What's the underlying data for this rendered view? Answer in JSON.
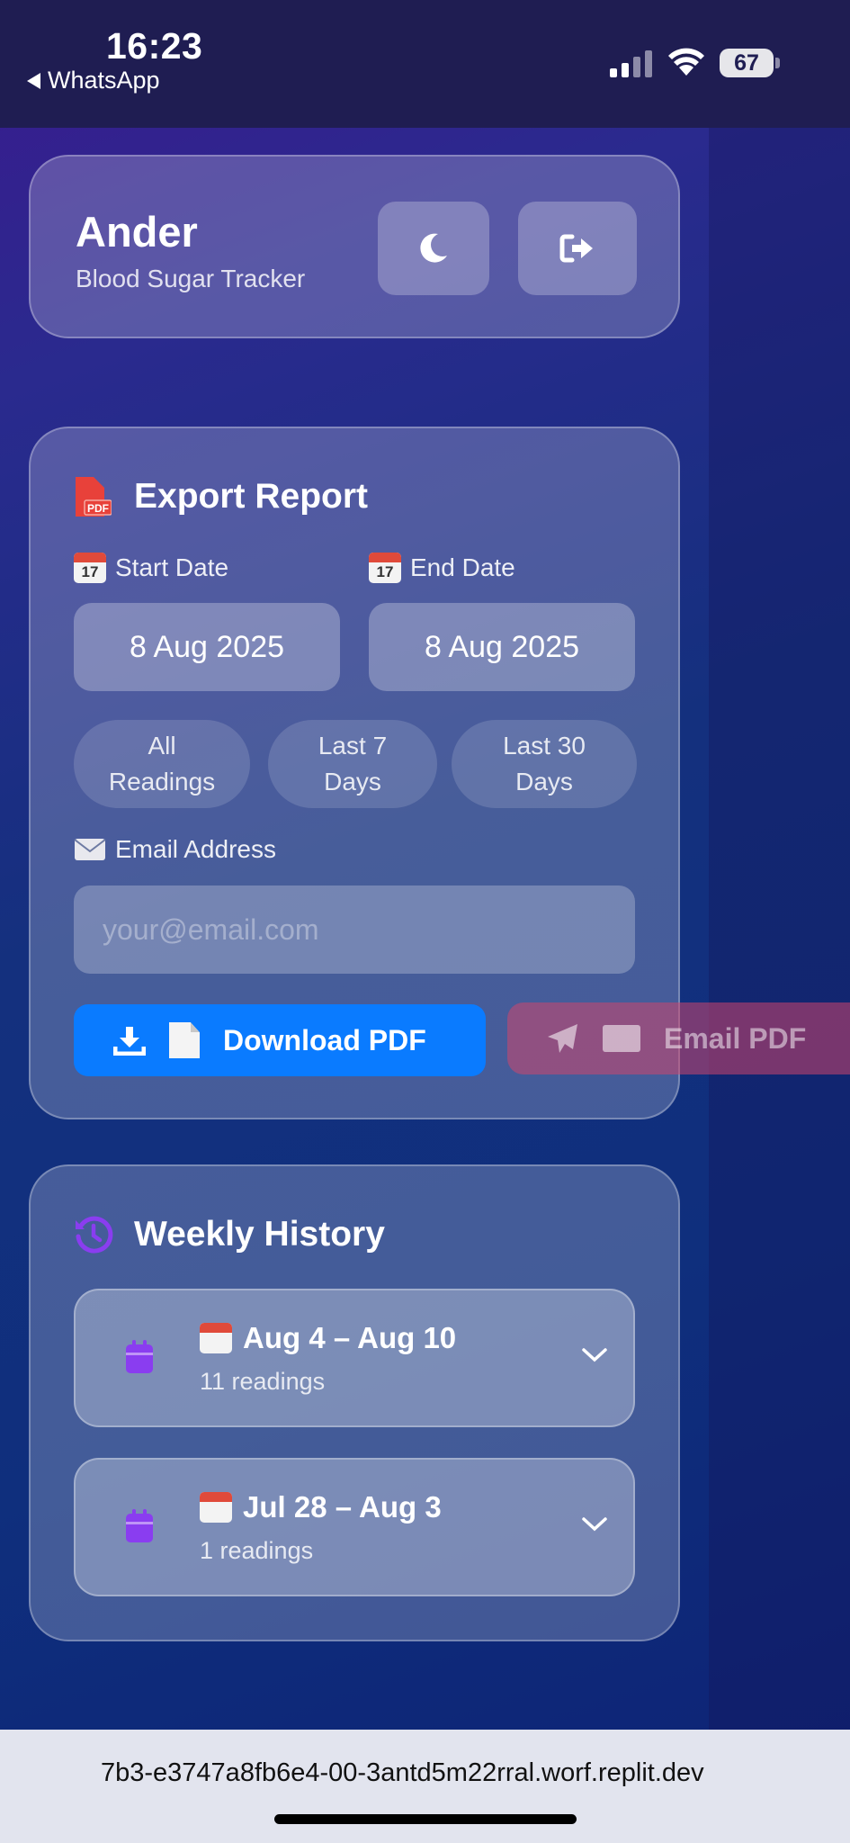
{
  "status_bar": {
    "time": "16:23",
    "back_app": "WhatsApp",
    "battery": "67"
  },
  "header": {
    "user_name": "Ander",
    "app_subtitle": "Blood Sugar Tracker",
    "theme_icon": "moon-icon",
    "logout_icon": "logout-icon"
  },
  "export": {
    "title": "Export Report",
    "start_date_label": "Start Date",
    "end_date_label": "End Date",
    "calendar_emoji_day": "17",
    "start_date_value": "8 Aug 2025",
    "end_date_value": "8 Aug 2025",
    "range_buttons": [
      {
        "line1": "All",
        "line2": "Readings"
      },
      {
        "line1": "Last 7",
        "line2": "Days"
      },
      {
        "line1": "Last 30",
        "line2": "Days"
      }
    ],
    "email_label": "Email Address",
    "email_placeholder": "your@email.com",
    "email_value": "",
    "download_label": "Download PDF",
    "email_pdf_label": "Email PDF",
    "colors": {
      "download": "#0a7bff",
      "pdf_icon": "#e8413a",
      "accent": "#8a3df0"
    }
  },
  "history": {
    "title": "Weekly History",
    "weeks": [
      {
        "range": "Aug 4 – Aug 10",
        "count": "11 readings"
      },
      {
        "range": "Jul 28 – Aug 3",
        "count": "1 readings"
      }
    ]
  },
  "browser": {
    "url": "7b3-e3747a8fb6e4-00-3antd5m22rral.worf.replit.dev"
  }
}
